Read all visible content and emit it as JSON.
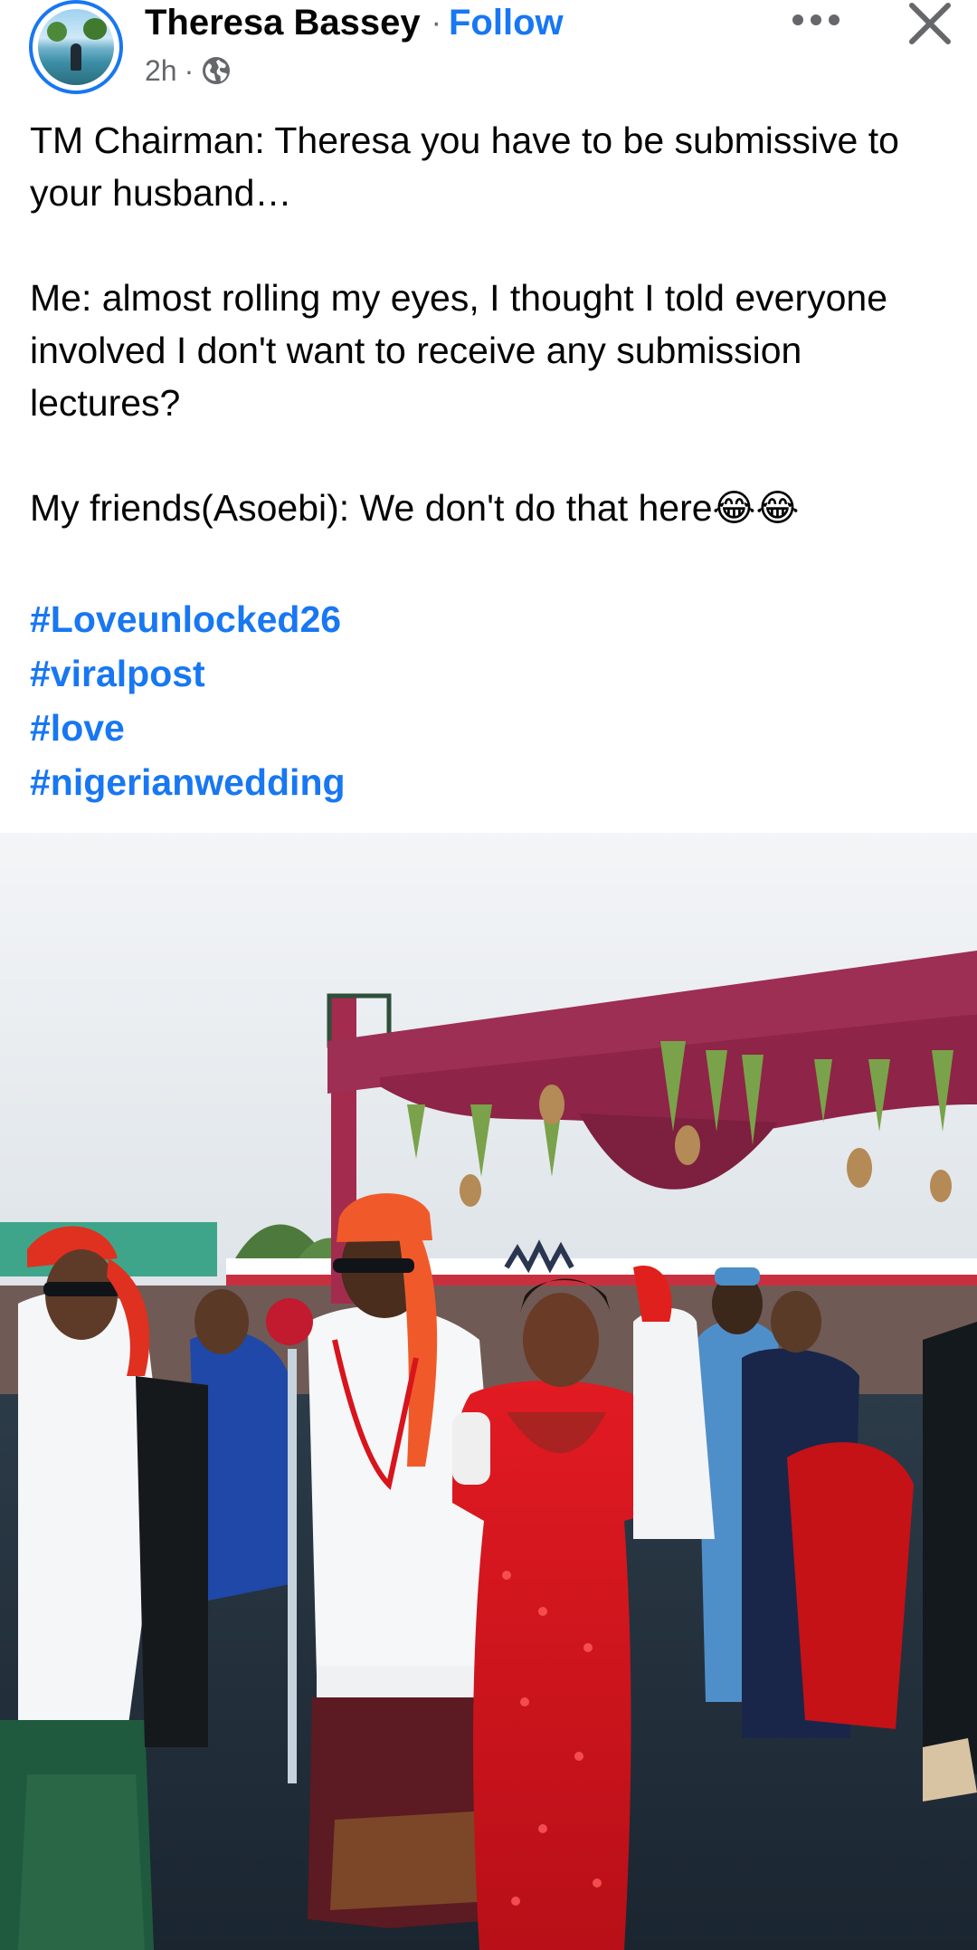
{
  "post": {
    "author": "Theresa Bassey",
    "separator": "·",
    "follow_label": "Follow",
    "time": "2h",
    "meta_separator": "·",
    "paragraphs": [
      "TM Chairman: Theresa you have to be submissive to your husband…",
      "Me: almost rolling my eyes, I thought I told everyone involved I don't want to receive any submission lectures?",
      "My friends(Asoebi): We don't do that here😂😂"
    ],
    "hashtags": [
      "#Loveunlocked26",
      "#viralpost",
      "#love",
      "#nigerianwedding"
    ]
  },
  "icons": {
    "more": "more-horizontal-icon",
    "close": "close-icon",
    "audience": "globe-icon"
  },
  "colors": {
    "accent": "#1877f2",
    "text": "#050505",
    "secondary": "#65676b",
    "canopy": "#9b2f52",
    "dress": "#d8141c",
    "cap": "#f05a2a"
  }
}
